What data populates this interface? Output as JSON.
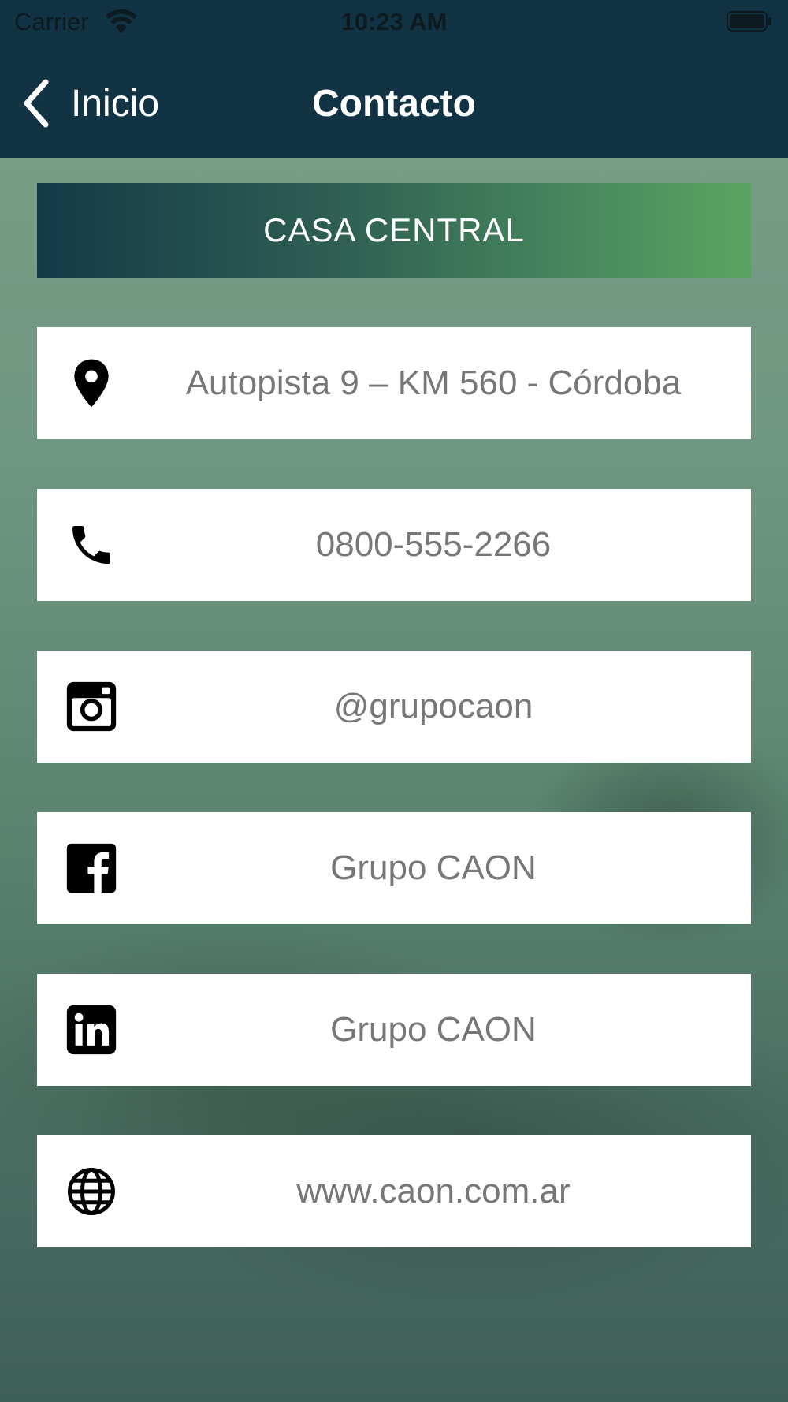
{
  "status_bar": {
    "carrier": "Carrier",
    "time": "10:23 AM"
  },
  "nav": {
    "back_label": "Inicio",
    "title": "Contacto"
  },
  "section": {
    "title": "CASA CENTRAL"
  },
  "contacts": [
    {
      "icon": "location-pin-icon",
      "text": "Autopista 9 – KM 560 - Córdoba"
    },
    {
      "icon": "phone-icon",
      "text": "0800-555-2266"
    },
    {
      "icon": "instagram-icon",
      "text": "@grupocaon"
    },
    {
      "icon": "facebook-icon",
      "text": "Grupo CAON"
    },
    {
      "icon": "linkedin-icon",
      "text": "Grupo CAON"
    },
    {
      "icon": "globe-icon",
      "text": "www.caon.com.ar"
    }
  ],
  "colors": {
    "nav_bg": "#113344",
    "header_start": "#143a47",
    "header_end": "#5aa462",
    "card_text": "#777777"
  }
}
